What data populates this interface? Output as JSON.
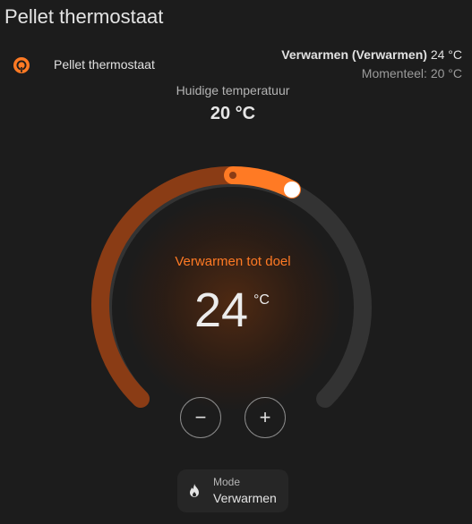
{
  "header": {
    "title": "Pellet thermostaat"
  },
  "entity": {
    "name": "Pellet thermostaat",
    "icon": "thermostat-icon",
    "state_bold": "Verwarmen (Verwarmen)",
    "state_target": "24 °C",
    "state_current": "Momenteel: 20 °C"
  },
  "current": {
    "label": "Huidige temperatuur",
    "value": "20 °C"
  },
  "dial": {
    "action": "Verwarmen tot doel",
    "target": "24",
    "unit": "°C",
    "accent_color": "#ff7a24",
    "track_color": "#333333",
    "heat_fill_color": "#8a3c15"
  },
  "controls": {
    "minus_symbol": "−",
    "plus_symbol": "+"
  },
  "mode": {
    "label": "Mode",
    "value": "Verwarmen",
    "icon": "flame-icon"
  }
}
